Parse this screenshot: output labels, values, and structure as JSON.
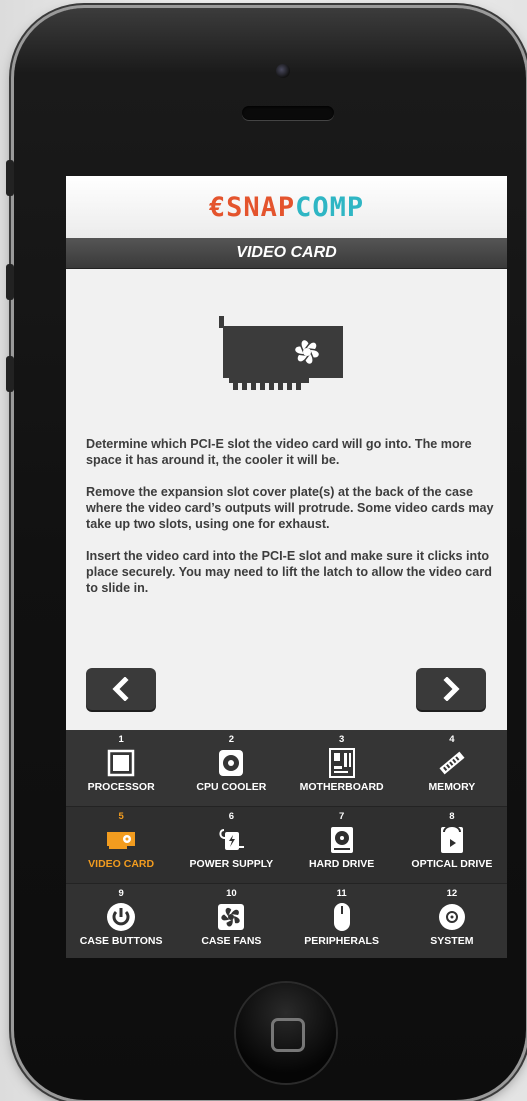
{
  "app": {
    "logo_part1": "€SNAP",
    "logo_part2": "COMP",
    "page_title": "VIDEO CARD"
  },
  "hero": {
    "icon": "video-card-icon"
  },
  "instructions": [
    "Determine which PCI-E slot the video card will go into. The more space it has around it, the cooler it will be.",
    "Remove the expansion slot cover plate(s) at the back of the case where the video card’s outputs will protrude. Some video cards may take up two slots, using one for exhaust.",
    "Insert the video card into the PCI-E slot and make sure it clicks into place securely. You may need to lift the latch to allow the video card to slide in."
  ],
  "navigation": {
    "prev_icon": "chevron-left-icon",
    "next_icon": "chevron-right-icon"
  },
  "steps": [
    {
      "num": "1",
      "label": "PROCESSOR",
      "icon": "processor-icon"
    },
    {
      "num": "2",
      "label": "CPU COOLER",
      "icon": "fan-icon"
    },
    {
      "num": "3",
      "label": "MOTHERBOARD",
      "icon": "motherboard-icon"
    },
    {
      "num": "4",
      "label": "MEMORY",
      "icon": "memory-icon"
    },
    {
      "num": "5",
      "label": "VIDEO CARD",
      "icon": "video-card-icon",
      "active": true
    },
    {
      "num": "6",
      "label": "POWER SUPPLY",
      "icon": "power-plug-icon"
    },
    {
      "num": "7",
      "label": "HARD DRIVE",
      "icon": "hard-drive-icon"
    },
    {
      "num": "8",
      "label": "OPTICAL DRIVE",
      "icon": "optical-drive-icon"
    },
    {
      "num": "9",
      "label": "CASE BUTTONS",
      "icon": "power-button-icon"
    },
    {
      "num": "10",
      "label": "CASE FANS",
      "icon": "case-fan-icon"
    },
    {
      "num": "11",
      "label": "PERIPHERALS",
      "icon": "mouse-icon"
    },
    {
      "num": "12",
      "label": "SYSTEM",
      "icon": "disc-icon"
    }
  ],
  "colors": {
    "active": "#f29c1f",
    "logo_red": "#e4542d",
    "logo_cyan": "#2fb6c4",
    "dark_bar": "#3a3a3a"
  }
}
